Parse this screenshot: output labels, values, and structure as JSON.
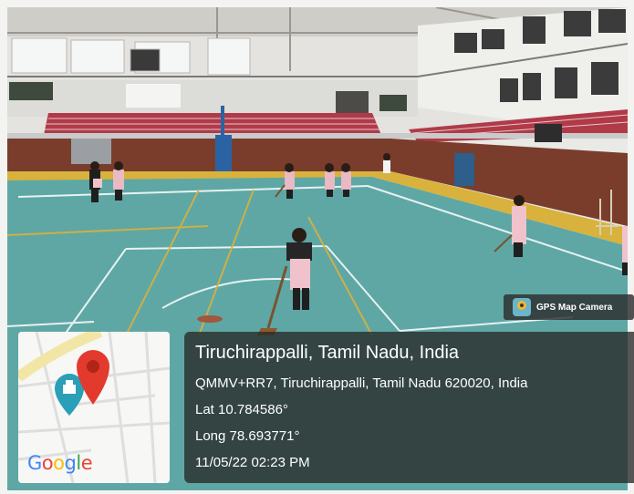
{
  "badge": {
    "app_name": "GPS Map Camera",
    "logo_icon": "gps-map-camera-logo"
  },
  "map": {
    "google_letters": [
      {
        "ch": "G",
        "color": "#4285F4"
      },
      {
        "ch": "o",
        "color": "#EA4335"
      },
      {
        "ch": "o",
        "color": "#FBBC05"
      },
      {
        "ch": "g",
        "color": "#4285F4"
      },
      {
        "ch": "l",
        "color": "#34A853"
      },
      {
        "ch": "e",
        "color": "#EA4335"
      }
    ],
    "pin_icon": "red-location-pin",
    "poi_icon": "landmark-icon"
  },
  "location": {
    "title": "Tiruchirappalli, Tamil Nadu, India",
    "address": "QMMV+RR7, Tiruchirappalli, Tamil Nadu 620020, India",
    "lat": "Lat 10.784586°",
    "long": "Long 78.693771°",
    "datetime": "11/05/22 02:23 PM"
  },
  "colors": {
    "court": "#5ea7a5",
    "court_border": "#d8b23c",
    "wall": "#7a3d2c",
    "seats": "#b13a48",
    "panel": "#282828"
  }
}
